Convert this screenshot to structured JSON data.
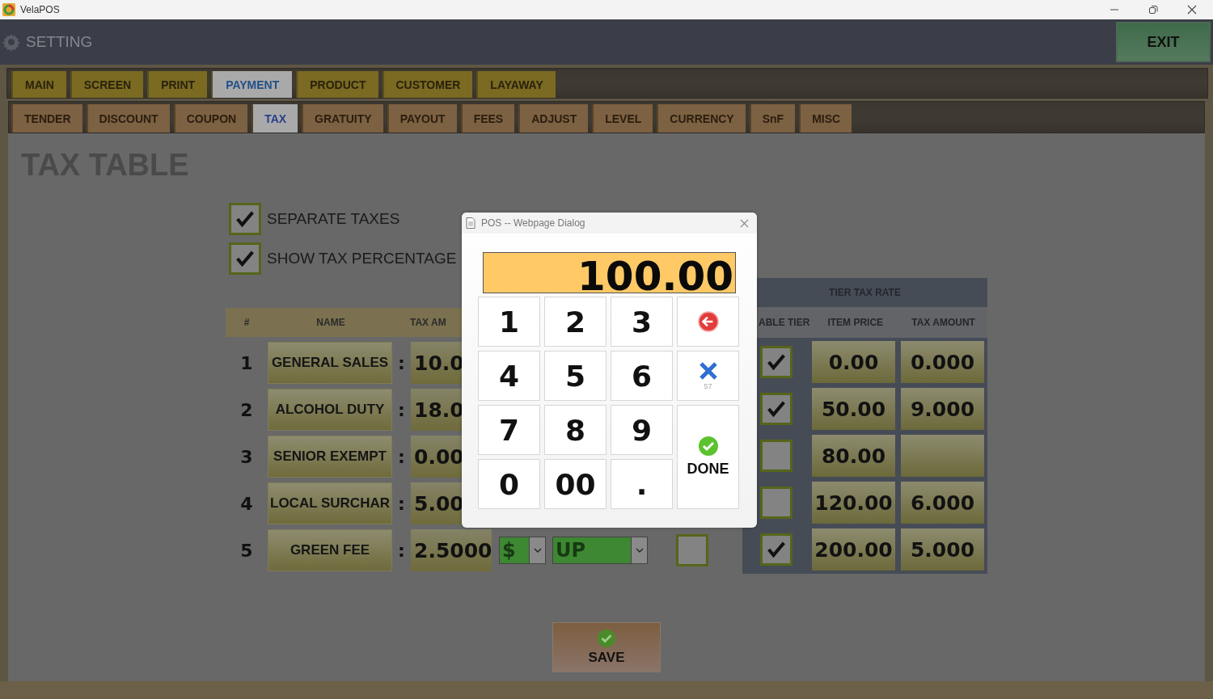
{
  "window": {
    "title": "VelaPOS"
  },
  "header": {
    "title": "SETTING",
    "exit_button": "EXIT"
  },
  "main_tabs": [
    {
      "label": "MAIN",
      "selected": false
    },
    {
      "label": "SCREEN",
      "selected": false
    },
    {
      "label": "PRINT",
      "selected": false
    },
    {
      "label": "PAYMENT",
      "selected": true
    },
    {
      "label": "PRODUCT",
      "selected": false
    },
    {
      "label": "CUSTOMER",
      "selected": false
    },
    {
      "label": "LAYAWAY",
      "selected": false
    }
  ],
  "sub_tabs": [
    {
      "label": "TENDER",
      "selected": false
    },
    {
      "label": "DISCOUNT",
      "selected": false
    },
    {
      "label": "COUPON",
      "selected": false
    },
    {
      "label": "TAX",
      "selected": true
    },
    {
      "label": "GRATUITY",
      "selected": false
    },
    {
      "label": "PAYOUT",
      "selected": false
    },
    {
      "label": "FEES",
      "selected": false
    },
    {
      "label": "ADJUST",
      "selected": false
    },
    {
      "label": "LEVEL",
      "selected": false
    },
    {
      "label": "CURRENCY",
      "selected": false
    },
    {
      "label": "SnF",
      "selected": false
    },
    {
      "label": "MISC",
      "selected": false
    }
  ],
  "page_title": "TAX TABLE",
  "options": [
    {
      "label": "SEPARATE TAXES",
      "checked": true
    },
    {
      "label": "SHOW TAX PERCENTAGE",
      "checked": true
    }
  ],
  "tax_table": {
    "columns": [
      "#",
      "NAME",
      "TAX AM"
    ],
    "rows": [
      {
        "number": "1",
        "name": "GENERAL SALES",
        "separator": ":",
        "amount": "10.0"
      },
      {
        "number": "2",
        "name": "ALCOHOL DUTY",
        "separator": ":",
        "amount": "18.0"
      },
      {
        "number": "3",
        "name": "SENIOR EXEMPT",
        "separator": ":",
        "amount": "0.00"
      },
      {
        "number": "4",
        "name": "LOCAL SURCHAR",
        "separator": ":",
        "amount": "5.00"
      },
      {
        "number": "5",
        "name": "GREEN FEE",
        "separator": ":",
        "amount": "2.5000",
        "unit": "$",
        "rounding": "UP",
        "flag_checked": false
      }
    ]
  },
  "tier_table": {
    "title": "TIER TAX RATE",
    "columns": [
      "ABLE TIER",
      "ITEM PRICE",
      "TAX AMOUNT"
    ],
    "rows": [
      {
        "enabled": true,
        "item_price": "0.00",
        "tax_amount": "0.000"
      },
      {
        "enabled": true,
        "item_price": "50.00",
        "tax_amount": "9.000"
      },
      {
        "enabled": false,
        "item_price": "80.00"
      },
      {
        "enabled": false,
        "item_price": "120.00",
        "tax_amount": "6.000"
      },
      {
        "enabled": true,
        "item_price": "200.00",
        "tax_amount": "5.000"
      }
    ]
  },
  "save_button": "SAVE",
  "dialog": {
    "title": "POS -- Webpage Dialog",
    "display": "100.00",
    "keys": [
      {
        "kind": "digit",
        "label": "1"
      },
      {
        "kind": "digit",
        "label": "2"
      },
      {
        "kind": "digit",
        "label": "3"
      },
      {
        "kind": "backspace"
      },
      {
        "kind": "digit",
        "label": "4"
      },
      {
        "kind": "digit",
        "label": "5"
      },
      {
        "kind": "digit",
        "label": "6"
      },
      {
        "kind": "clear",
        "caption": "57"
      },
      {
        "kind": "digit",
        "label": "7"
      },
      {
        "kind": "digit",
        "label": "8"
      },
      {
        "kind": "digit",
        "label": "9"
      },
      {
        "kind": "done",
        "label": "DONE"
      },
      {
        "kind": "digit",
        "label": "0"
      },
      {
        "kind": "digit",
        "label": "00"
      },
      {
        "kind": "digit",
        "label": "."
      }
    ]
  }
}
